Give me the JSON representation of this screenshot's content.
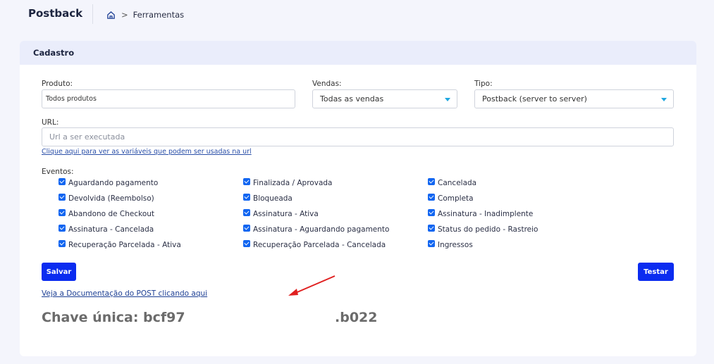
{
  "header": {
    "title": "Postback",
    "breadcrumb": {
      "separator": ">",
      "current": "Ferramentas"
    }
  },
  "card": {
    "title": "Cadastro",
    "produto": {
      "label": "Produto:",
      "value": "Todos produtos"
    },
    "vendas": {
      "label": "Vendas:",
      "value": "Todas as vendas"
    },
    "tipo": {
      "label": "Tipo:",
      "value": "Postback (server to server)"
    },
    "url": {
      "label": "URL:",
      "placeholder": "Url a ser executada"
    },
    "var_link": "Clique aqui para ver as variáveis que podem ser usadas na url",
    "eventos_label": "Eventos:",
    "events": [
      {
        "label": "Aguardando pagamento",
        "checked": true
      },
      {
        "label": "Finalizada / Aprovada",
        "checked": true
      },
      {
        "label": "Cancelada",
        "checked": true
      },
      {
        "label": "Devolvida (Reembolso)",
        "checked": true
      },
      {
        "label": "Bloqueada",
        "checked": true
      },
      {
        "label": "Completa",
        "checked": true
      },
      {
        "label": "Abandono de Checkout",
        "checked": true
      },
      {
        "label": "Assinatura - Ativa",
        "checked": true
      },
      {
        "label": "Assinatura - Inadimplente",
        "checked": true
      },
      {
        "label": "Assinatura - Cancelada",
        "checked": true
      },
      {
        "label": "Assinatura - Aguardando pagamento",
        "checked": true
      },
      {
        "label": "Status do pedido - Rastreio",
        "checked": true
      },
      {
        "label": "Recuperação Parcelada - Ativa",
        "checked": true
      },
      {
        "label": "Recuperação Parcelada - Cancelada",
        "checked": true
      },
      {
        "label": "Ingressos",
        "checked": true
      }
    ],
    "save_button": "Salvar",
    "test_button": "Testar",
    "doc_link": "Veja a Documentação do POST clicando aqui",
    "key": {
      "prefix": "Chave única: bcf97",
      "suffix": ".b022"
    }
  },
  "colors": {
    "primary_button": "#0b2cf0",
    "checkbox": "#1266f1",
    "arrow": "#e02020",
    "header_bg": "#eaedfb"
  }
}
